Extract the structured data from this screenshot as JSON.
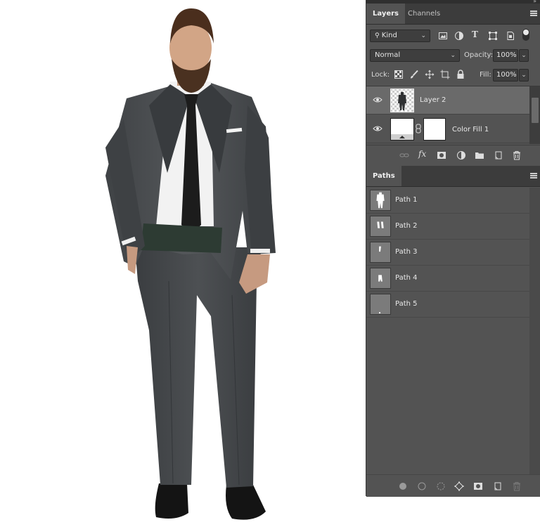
{
  "layers_panel": {
    "tabs": [
      {
        "label": "Layers"
      },
      {
        "label": "Channels"
      }
    ],
    "filter_kind": "Kind",
    "blend_mode": "Normal",
    "opacity_label": "Opacity:",
    "opacity_value": "100%",
    "lock_label": "Lock:",
    "fill_label": "Fill:",
    "fill_value": "100%",
    "layers": [
      {
        "name": "Layer 2",
        "visible": true,
        "selected": true
      },
      {
        "name": "Color Fill 1",
        "visible": true,
        "selected": false
      }
    ],
    "footer_fx": "fx"
  },
  "paths_panel": {
    "tab": "Paths",
    "paths": [
      {
        "name": "Path 1"
      },
      {
        "name": "Path 2"
      },
      {
        "name": "Path 3"
      },
      {
        "name": "Path 4"
      },
      {
        "name": "Path 5"
      }
    ]
  },
  "colors": {
    "panel_bg": "#535353",
    "tabbar_bg": "#3c3c3c",
    "selected_row": "#6a6a6a",
    "suit": "#4a4d50",
    "waistband": "#2d3b33"
  }
}
